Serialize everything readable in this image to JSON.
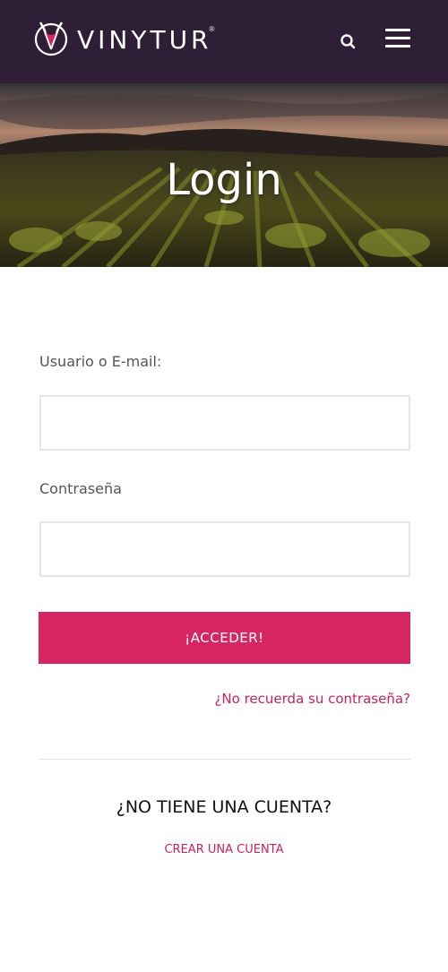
{
  "header": {
    "brand": "VINYTUR",
    "brand_mark": "®",
    "logo_icon": "wine-glass-v-logo",
    "search_icon": "search-icon",
    "menu_icon": "hamburger-menu-icon",
    "background_color": "#2e1f37"
  },
  "hero": {
    "title": "Login",
    "image": "vineyard-at-sunset"
  },
  "form": {
    "username_label": "Usuario o E-mail:",
    "username_value": "",
    "password_label": "Contraseña",
    "password_value": "",
    "submit_label": "¡ACCEDER!",
    "forgot_link": "¿No recuerda su contraseña?"
  },
  "signup": {
    "heading": "¿NO TIENE UNA CUENTA?",
    "create_link": "CREAR UNA CUENTA"
  },
  "colors": {
    "accent": "#d62561",
    "link": "#c8235b",
    "header": "#2e1f37"
  }
}
